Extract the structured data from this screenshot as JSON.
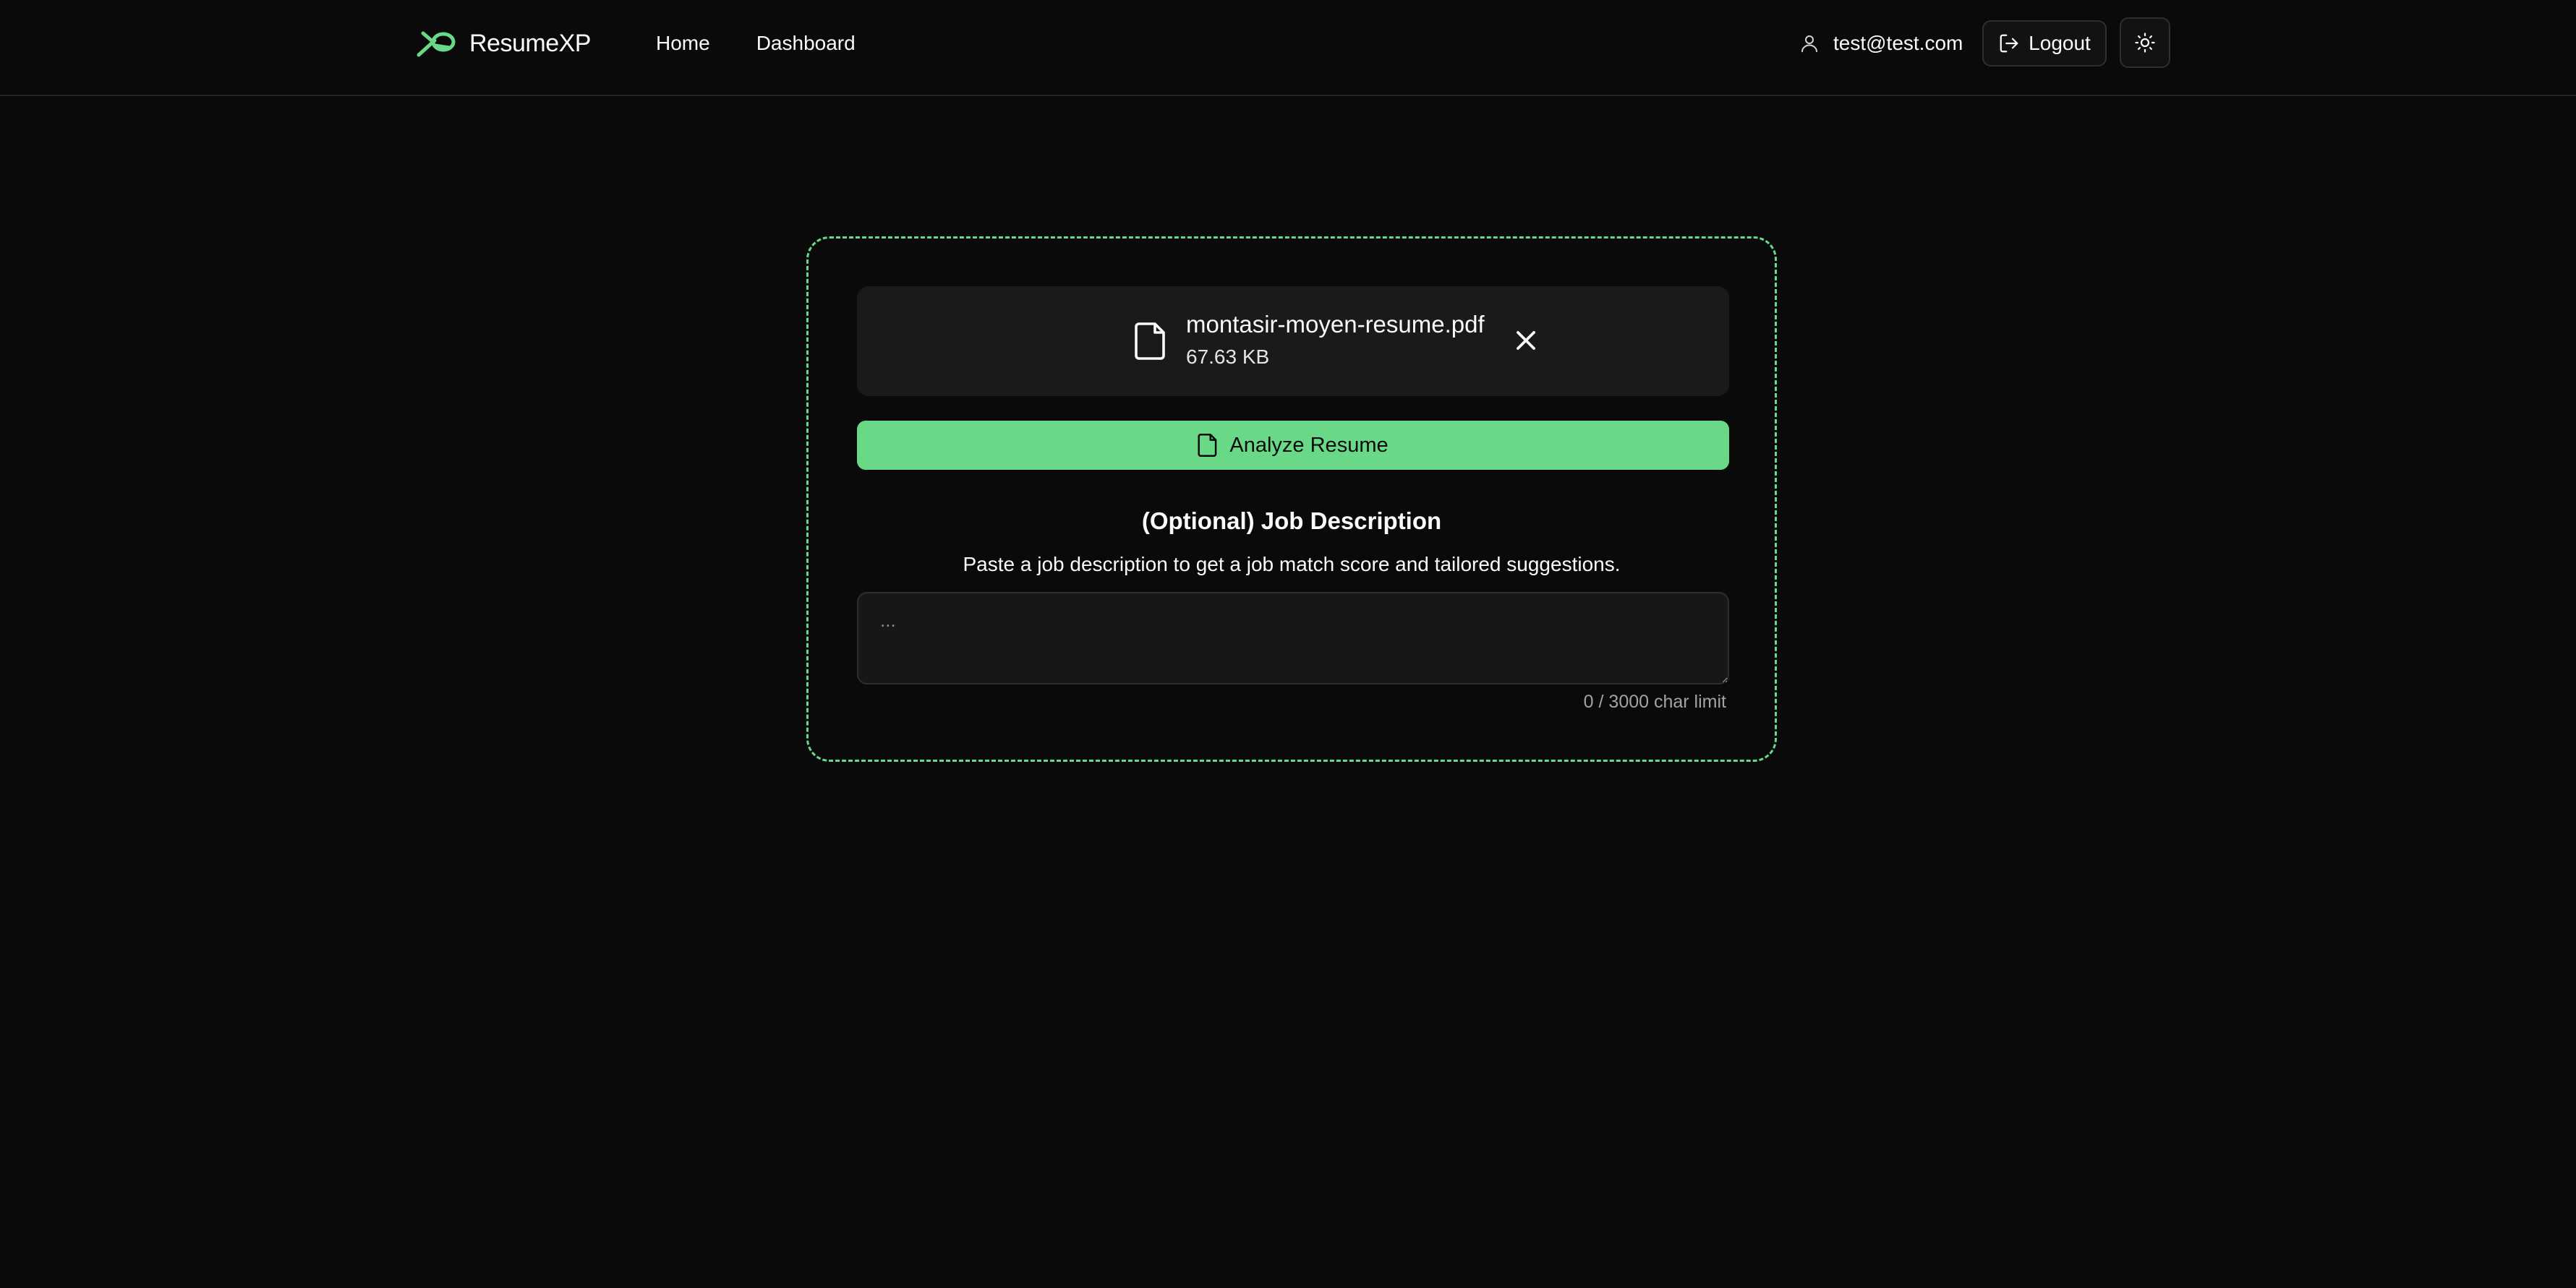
{
  "header": {
    "brand": "ResumeXP",
    "nav": [
      {
        "label": "Home"
      },
      {
        "label": "Dashboard"
      }
    ],
    "user_email": "test@test.com",
    "logout_label": "Logout",
    "theme_icon": "sun-icon"
  },
  "upload": {
    "file_name": "montasir-moyen-resume.pdf",
    "file_size": "67.63 KB",
    "analyze_label": "Analyze Resume"
  },
  "job_description": {
    "title": "(Optional) Job Description",
    "subtitle": "Paste a job description to get a job match score and tailored suggestions.",
    "placeholder": "...",
    "value": "",
    "char_limit_text": "0 / 3000 char limit"
  },
  "colors": {
    "background": "#0a0a0a",
    "accent": "#6ad987",
    "card": "#1a1a1a",
    "border": "#262626"
  }
}
